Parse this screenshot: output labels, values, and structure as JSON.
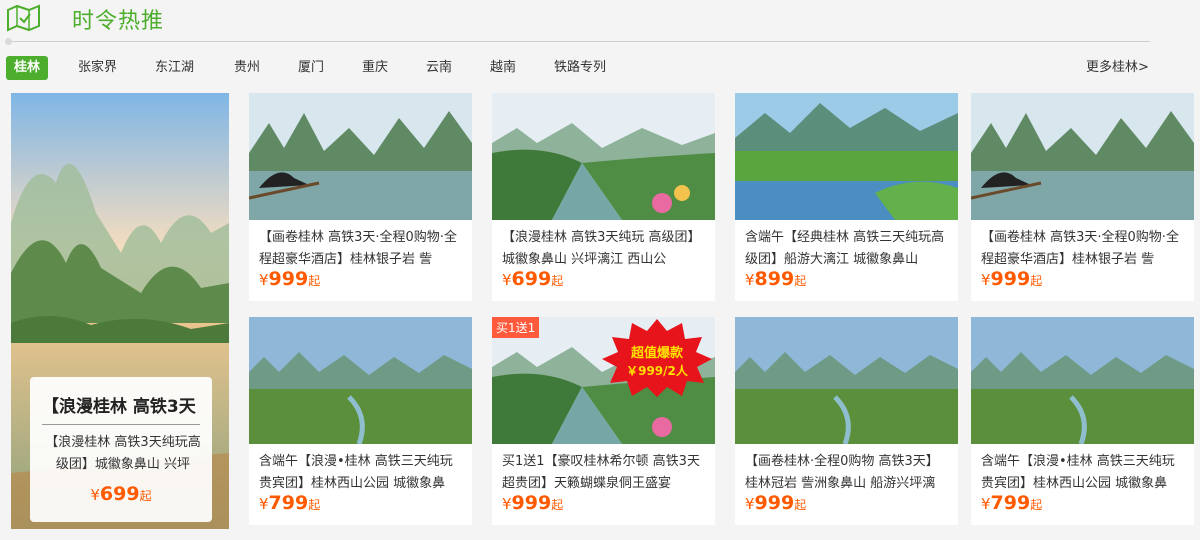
{
  "header": {
    "title": "时令热推",
    "icon": "map-icon",
    "accent": "#4cae2c"
  },
  "tabs": [
    {
      "label": "桂林",
      "active": true
    },
    {
      "label": "张家界"
    },
    {
      "label": "东江湖"
    },
    {
      "label": "贵州"
    },
    {
      "label": "厦门"
    },
    {
      "label": "重庆"
    },
    {
      "label": "云南"
    },
    {
      "label": "越南"
    },
    {
      "label": "铁路专列"
    }
  ],
  "more_label": "更多桂林>",
  "featured": {
    "title": "【浪漫桂林 高铁3天",
    "desc": "【浪漫桂林 高铁3天纯玩高级团】城徽象鼻山 兴坪",
    "currency": "¥",
    "price": "699",
    "suffix": "起"
  },
  "products": [
    {
      "desc": "【画卷桂林 高铁3天·全程0购物·全程超豪华酒店】桂林银子岩 訾",
      "currency": "¥",
      "price": "999",
      "suffix": "起"
    },
    {
      "desc": "【浪漫桂林 高铁3天纯玩 高级团】城徽象鼻山 兴坪漓江 西山公",
      "currency": "¥",
      "price": "699",
      "suffix": "起"
    },
    {
      "desc": "含端午【经典桂林 高铁三天纯玩高级团】船游大漓江 城徽象鼻山",
      "currency": "¥",
      "price": "899",
      "suffix": "起"
    },
    {
      "desc": "【画卷桂林 高铁3天·全程0购物·全程超豪华酒店】桂林银子岩 訾",
      "currency": "¥",
      "price": "999",
      "suffix": "起"
    },
    {
      "desc": "含端午【浪漫•桂林 高铁三天纯玩贵宾团】桂林西山公园 城徽象鼻",
      "currency": "¥",
      "price": "799",
      "suffix": "起"
    },
    {
      "desc": "买1送1【豪叹桂林希尔顿 高铁3天超贵团】天籁蝴蝶泉侗王盛宴",
      "currency": "¥",
      "price": "999",
      "suffix": "起",
      "badge": "买1送1",
      "promo_line1": "超值爆款",
      "promo_line2": "￥999/2人"
    },
    {
      "desc": "【画卷桂林·全程0购物 高铁3天】桂林冠岩 訾洲象鼻山 船游兴坪漓",
      "currency": "¥",
      "price": "999",
      "suffix": "起"
    },
    {
      "desc": "含端午【浪漫•桂林 高铁三天纯玩贵宾团】桂林西山公园 城徽象鼻",
      "currency": "¥",
      "price": "799",
      "suffix": "起"
    }
  ]
}
